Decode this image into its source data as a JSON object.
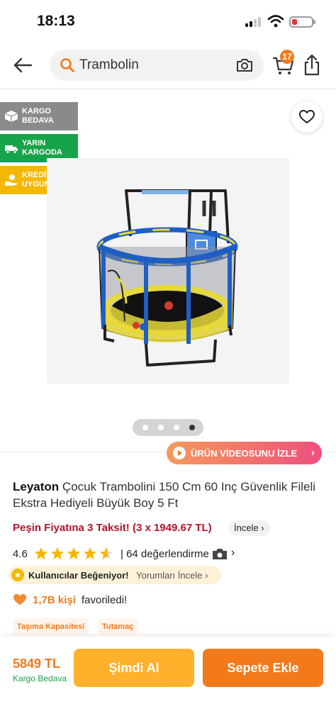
{
  "status_bar": {
    "time": "18:13"
  },
  "header": {
    "search_text": "Trambolin",
    "cart_count": "17",
    "icons": [
      "back-arrow-icon",
      "search-icon",
      "camera-icon",
      "cart-icon",
      "share-icon"
    ]
  },
  "badges": [
    {
      "label": "KARGO BEDAVA",
      "color": "#8a8a8a",
      "icon": "box-icon"
    },
    {
      "label": "YARIN KARGODA",
      "color": "#17a34a",
      "icon": "truck-icon"
    },
    {
      "label": "KREDİYE UYGUN",
      "color": "#f5b800",
      "icon": "credit-icon"
    }
  ],
  "gallery": {
    "total_images": 4,
    "active_index": 4
  },
  "video_button": {
    "label": "ÜRÜN VİDEOSUNU İZLE"
  },
  "product": {
    "brand": "Leyaton",
    "name": " Çocuk Trambolini 150 Cm 60 Inç Güvenlik Fileli Ekstra Hediyeli Büyük Boy 5 Ft",
    "installment_text": "Peşin Fiyatına 3 Taksit! (3 x 1949.67 TL)",
    "installment_link": "İncele ›",
    "rating": "4.6",
    "rating_value": 4.6,
    "review_count_text": "| 64 değerlendirme",
    "liked_text": "Kullanıcılar Beğeniyor!",
    "reviews_link": "Yorumları İncele ›",
    "favorite_count": "1,7B kişi",
    "favorite_text": "favoriledi!",
    "tags": [
      "Taşıma Kapasitesi",
      "Tutamaç"
    ]
  },
  "bottom_bar": {
    "price": "5849 TL",
    "cargo": "Kargo Bedava",
    "buy_now": "Şimdi Al",
    "add_to_cart": "Sepete Ekle"
  },
  "colors": {
    "accent": "#f27a1a",
    "buy_now": "#ffb12b",
    "installment": "#b3142a",
    "success": "#17a34a"
  }
}
